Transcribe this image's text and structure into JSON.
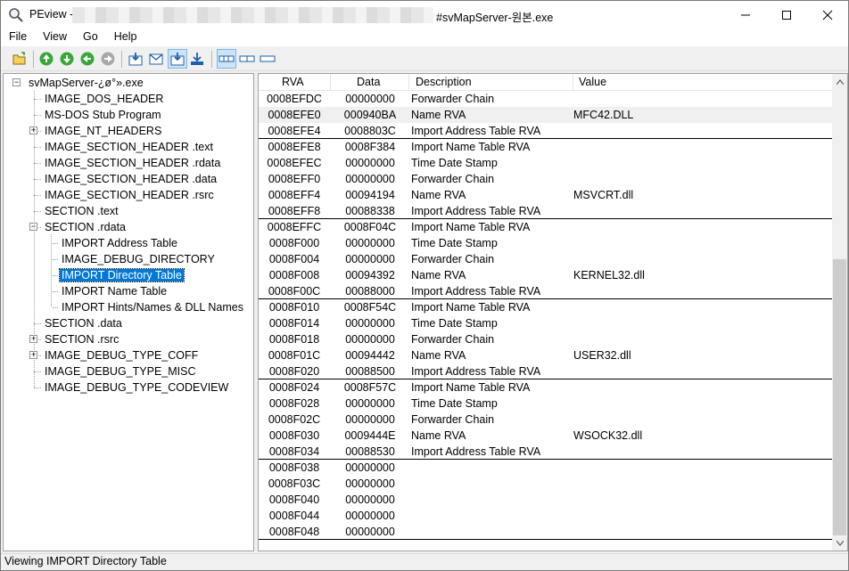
{
  "window": {
    "title_left": "PEview -",
    "title_right": "#svMapServer-원본.exe",
    "controls": {
      "minimize": "minimize-icon",
      "maximize": "maximize-icon",
      "close": "close-icon"
    }
  },
  "menu": [
    "File",
    "View",
    "Go",
    "Help"
  ],
  "toolbar": {
    "icons": [
      "open-folder-icon",
      "back-icon",
      "forward-icon",
      "previous-icon",
      "next-icon",
      "go-to-icon",
      "view-down-icon",
      "view-mail-icon",
      "save-icon",
      "download-icon",
      "list-view-icon",
      "split-view-icon",
      "single-view-icon"
    ]
  },
  "tree": {
    "items": [
      {
        "label": "svMapServer-¿ø°».exe",
        "level": 0,
        "expander": "-"
      },
      {
        "label": "IMAGE_DOS_HEADER",
        "level": 1,
        "expander": ""
      },
      {
        "label": "MS-DOS Stub Program",
        "level": 1,
        "expander": ""
      },
      {
        "label": "IMAGE_NT_HEADERS",
        "level": 1,
        "expander": "+"
      },
      {
        "label": "IMAGE_SECTION_HEADER .text",
        "level": 1,
        "expander": ""
      },
      {
        "label": "IMAGE_SECTION_HEADER .rdata",
        "level": 1,
        "expander": ""
      },
      {
        "label": "IMAGE_SECTION_HEADER .data",
        "level": 1,
        "expander": ""
      },
      {
        "label": "IMAGE_SECTION_HEADER .rsrc",
        "level": 1,
        "expander": ""
      },
      {
        "label": "SECTION .text",
        "level": 1,
        "expander": ""
      },
      {
        "label": "SECTION .rdata",
        "level": 1,
        "expander": "-"
      },
      {
        "label": "IMPORT Address Table",
        "level": 2,
        "expander": ""
      },
      {
        "label": "IMAGE_DEBUG_DIRECTORY",
        "level": 2,
        "expander": ""
      },
      {
        "label": "IMPORT Directory Table",
        "level": 2,
        "expander": "",
        "selected": true
      },
      {
        "label": "IMPORT Name Table",
        "level": 2,
        "expander": ""
      },
      {
        "label": "IMPORT Hints/Names & DLL Names",
        "level": 2,
        "expander": ""
      },
      {
        "label": "SECTION .data",
        "level": 1,
        "expander": ""
      },
      {
        "label": "SECTION .rsrc",
        "level": 1,
        "expander": "+"
      },
      {
        "label": "IMAGE_DEBUG_TYPE_COFF",
        "level": 1,
        "expander": "+"
      },
      {
        "label": "IMAGE_DEBUG_TYPE_MISC",
        "level": 1,
        "expander": ""
      },
      {
        "label": "IMAGE_DEBUG_TYPE_CODEVIEW",
        "level": 1,
        "expander": ""
      }
    ]
  },
  "table": {
    "columns": [
      "RVA",
      "Data",
      "Description",
      "Value"
    ],
    "rows": [
      [
        "0008EFDC",
        "00000000",
        "Forwarder Chain",
        ""
      ],
      [
        "0008EFE0",
        "000940BA",
        "Name RVA",
        "MFC42.DLL"
      ],
      [
        "0008EFE4",
        "0008803C",
        "Import Address Table RVA",
        ""
      ],
      [
        "0008EFE8",
        "0008F384",
        "Import Name Table RVA",
        ""
      ],
      [
        "0008EFEC",
        "00000000",
        "Time Date Stamp",
        ""
      ],
      [
        "0008EFF0",
        "00000000",
        "Forwarder Chain",
        ""
      ],
      [
        "0008EFF4",
        "00094194",
        "Name RVA",
        "MSVCRT.dll"
      ],
      [
        "0008EFF8",
        "00088338",
        "Import Address Table RVA",
        ""
      ],
      [
        "0008EFFC",
        "0008F04C",
        "Import Name Table RVA",
        ""
      ],
      [
        "0008F000",
        "00000000",
        "Time Date Stamp",
        ""
      ],
      [
        "0008F004",
        "00000000",
        "Forwarder Chain",
        ""
      ],
      [
        "0008F008",
        "00094392",
        "Name RVA",
        "KERNEL32.dll"
      ],
      [
        "0008F00C",
        "00088000",
        "Import Address Table RVA",
        ""
      ],
      [
        "0008F010",
        "0008F54C",
        "Import Name Table RVA",
        ""
      ],
      [
        "0008F014",
        "00000000",
        "Time Date Stamp",
        ""
      ],
      [
        "0008F018",
        "00000000",
        "Forwarder Chain",
        ""
      ],
      [
        "0008F01C",
        "00094442",
        "Name RVA",
        "USER32.dll"
      ],
      [
        "0008F020",
        "00088500",
        "Import Address Table RVA",
        ""
      ],
      [
        "0008F024",
        "0008F57C",
        "Import Name Table RVA",
        ""
      ],
      [
        "0008F028",
        "00000000",
        "Time Date Stamp",
        ""
      ],
      [
        "0008F02C",
        "00000000",
        "Forwarder Chain",
        ""
      ],
      [
        "0008F030",
        "0009444E",
        "Name RVA",
        "WSOCK32.dll"
      ],
      [
        "0008F034",
        "00088530",
        "Import Address Table RVA",
        ""
      ],
      [
        "0008F038",
        "00000000",
        "",
        ""
      ],
      [
        "0008F03C",
        "00000000",
        "",
        ""
      ],
      [
        "0008F040",
        "00000000",
        "",
        ""
      ],
      [
        "0008F044",
        "00000000",
        "",
        ""
      ],
      [
        "0008F048",
        "00000000",
        "",
        ""
      ]
    ],
    "highlighted_row": 1,
    "group_separators_after": [
      2,
      7,
      12,
      17,
      22,
      27
    ]
  },
  "status": {
    "text": "Viewing IMPORT Directory Table"
  },
  "colors": {
    "selection": "#0078d7",
    "row_highlight": "#f0f0f0",
    "window_bg": "#f0f0f0"
  }
}
